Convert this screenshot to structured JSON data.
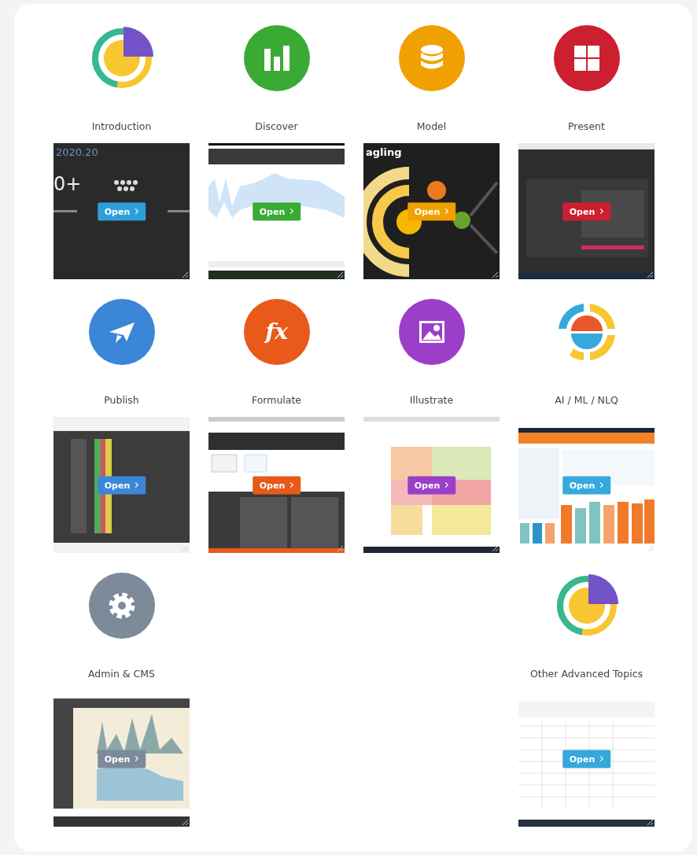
{
  "rows": [
    {
      "tiles": [
        {
          "label": "Introduction",
          "icon": {
            "kind": "pie"
          },
          "color": "#2d9fd9",
          "preview": {
            "kind": "dark-slide",
            "texts": [
              "2020.20",
              "0+"
            ]
          },
          "button": "Open"
        },
        {
          "label": "Discover",
          "icon": {
            "kind": "bars"
          },
          "color": "#3aaa35",
          "preview": {
            "kind": "line-chart"
          },
          "button": "Open"
        },
        {
          "label": "Model",
          "icon": {
            "kind": "database"
          },
          "color": "#f0a000",
          "preview": {
            "kind": "radial",
            "texts": [
              "agling"
            ]
          },
          "button": "Open"
        },
        {
          "label": "Present",
          "icon": {
            "kind": "grid"
          },
          "color": "#cc1f30",
          "preview": {
            "kind": "dark-dashboard"
          },
          "button": "Open"
        }
      ]
    },
    {
      "tiles": [
        {
          "label": "Publish",
          "icon": {
            "kind": "plane"
          },
          "color": "#3b86d6",
          "preview": {
            "kind": "dark-table"
          },
          "button": "Open"
        },
        {
          "label": "Formulate",
          "icon": {
            "kind": "glyph",
            "glyph": "fx"
          },
          "color": "#e8591a",
          "preview": {
            "kind": "dark-editor"
          },
          "button": "Open"
        },
        {
          "label": "Illustrate",
          "icon": {
            "kind": "image"
          },
          "color": "#9b3fc9",
          "preview": {
            "kind": "floor-plan"
          },
          "button": "Open"
        },
        {
          "label": "AI / ML / NLQ",
          "icon": {
            "kind": "ai"
          },
          "color": "#35a8dc",
          "preview": {
            "kind": "bar-dashboard"
          },
          "button": "Open"
        }
      ]
    },
    {
      "tiles": [
        {
          "label": "Admin & CMS",
          "icon": {
            "kind": "gear"
          },
          "color": "#7d8a9a",
          "preview": {
            "kind": "area-chart"
          },
          "button": "Open"
        },
        {
          "label": "Other Advanced Topics",
          "icon": {
            "kind": "pie"
          },
          "color": "#35a8dc",
          "preview": {
            "kind": "spreadsheet"
          },
          "button": "Open"
        }
      ]
    }
  ]
}
